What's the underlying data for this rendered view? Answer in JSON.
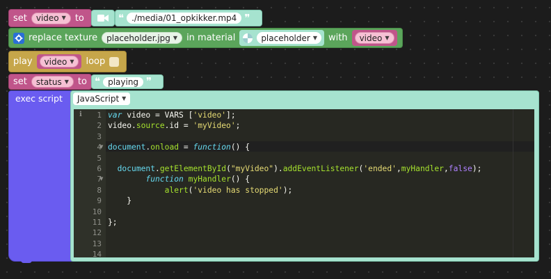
{
  "blocks": {
    "set_video": {
      "set": "set",
      "var": "video",
      "to": "to",
      "value": "./media/01_opkikker.mp4",
      "video_icon": "video-camera-icon"
    },
    "replace_texture": {
      "label": "replace texture",
      "texture": "placeholder.jpg",
      "in_material": "in material",
      "material": "placeholder",
      "with": "with",
      "var": "video",
      "icon": "settings-gear-icon"
    },
    "play": {
      "play": "play",
      "var": "video",
      "loop": "loop"
    },
    "set_status": {
      "set": "set",
      "var": "status",
      "to": "to",
      "value": "playing"
    },
    "exec": {
      "label": "exec script",
      "language": "JavaScript"
    }
  },
  "editor": {
    "lines": [
      {
        "n": "1",
        "text": "var video = VARS ['video'];"
      },
      {
        "n": "2",
        "text": "video.source.id = 'myVideo';"
      },
      {
        "n": "3",
        "text": ""
      },
      {
        "n": "4",
        "text": "document.onload = function() {"
      },
      {
        "n": "5",
        "text": ""
      },
      {
        "n": "6",
        "text": "  document.getElementById(\"myVideo\").addEventListener('ended',myHandler,false);"
      },
      {
        "n": "7",
        "text": "        function myHandler() {"
      },
      {
        "n": "8",
        "text": "            alert('video has stopped');"
      },
      {
        "n": "9",
        "text": "    }"
      },
      {
        "n": "10",
        "text": ""
      },
      {
        "n": "11",
        "text": "};"
      },
      {
        "n": "12",
        "text": ""
      },
      {
        "n": "13",
        "text": ""
      },
      {
        "n": "14",
        "text": ""
      }
    ]
  },
  "colors": {
    "variables": "#c0558a",
    "texture": "#5ba55b",
    "play": "#c6a64a",
    "exec": "#6a5cf0",
    "string": "#a6e3cf",
    "editor_bg": "#272822"
  }
}
